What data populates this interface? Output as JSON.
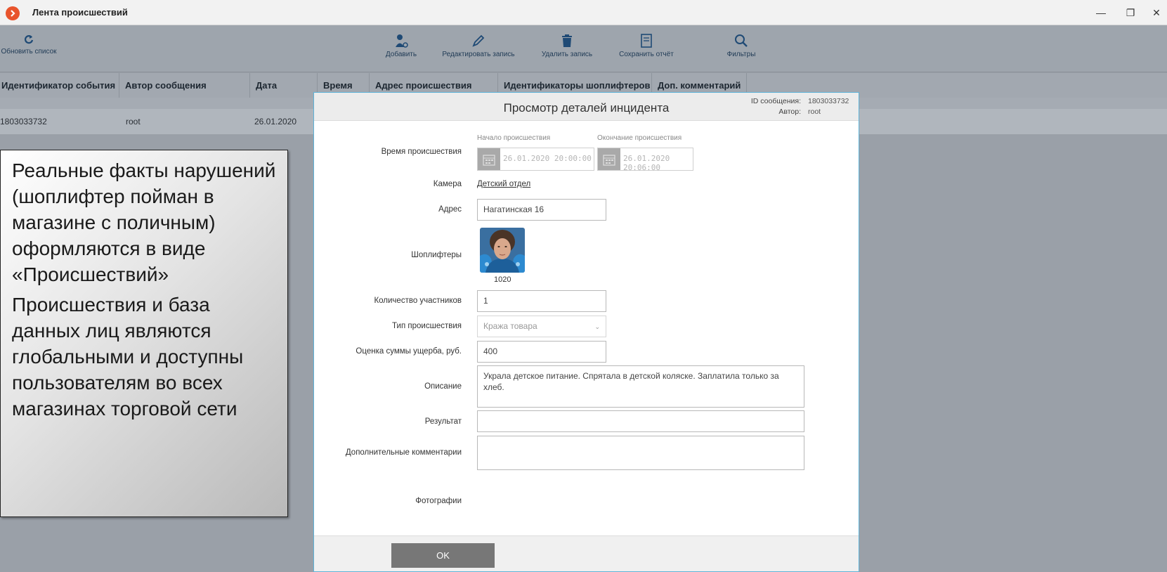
{
  "window": {
    "title": "Лента происшествий",
    "controls": {
      "minimize": "—",
      "restore": "❐",
      "close": "✕"
    }
  },
  "toolbar": {
    "refresh": "Обновить список",
    "add": "Добавить",
    "edit": "Редактировать запись",
    "delete": "Удалить запись",
    "save_report": "Сохранить отчёт",
    "filters": "Фильтры"
  },
  "table": {
    "columns": [
      "Идентификатор события",
      "Автор сообщения",
      "Дата",
      "Время",
      "Адрес происшествия",
      "Идентификаторы шоплифтеров",
      "Доп. комментарий"
    ],
    "rows": [
      {
        "id": "1803033732",
        "author": "root",
        "date": "26.01.2020"
      }
    ]
  },
  "callout": {
    "p1": "Реальные факты нарушений (шоплифтер пойман в магазине с поличным) оформляются в виде «Происшествий»",
    "p2": "Происшествия и база данных лиц являются глобальными и доступны пользователям во всех магазинах торговой сети"
  },
  "modal": {
    "title": "Просмотр деталей инцидента",
    "meta": {
      "id_label": "ID сообщения:",
      "id_value": "1803033732",
      "author_label": "Автор:",
      "author_value": "root"
    },
    "labels": {
      "time": "Время происшествия",
      "camera": "Камера",
      "address": "Адрес",
      "shoplifters": "Шоплифтеры",
      "participants": "Количество участников",
      "type": "Тип происшествия",
      "damage": "Оценка суммы ущерба, руб.",
      "description": "Описание",
      "result": "Результат",
      "comments": "Дополнительные комментарии",
      "photos": "Фотографии"
    },
    "start_caption": "Начало происшествия",
    "end_caption": "Окончание происшествия",
    "start_value": "26.01.2020 20:00:00",
    "end_value": "26.01.2020 20:06:00",
    "camera_value": "Детский отдел",
    "address_value": "Нагатинская 16",
    "shoplifter_id": "1020",
    "participants_value": "1",
    "type_value": "Кража товара",
    "damage_value": "400",
    "description_value": "Украла детское питание. Спрятала в детской коляске. Заплатила только за хлеб.",
    "result_value": "",
    "comments_value": "",
    "ok": "OK"
  }
}
